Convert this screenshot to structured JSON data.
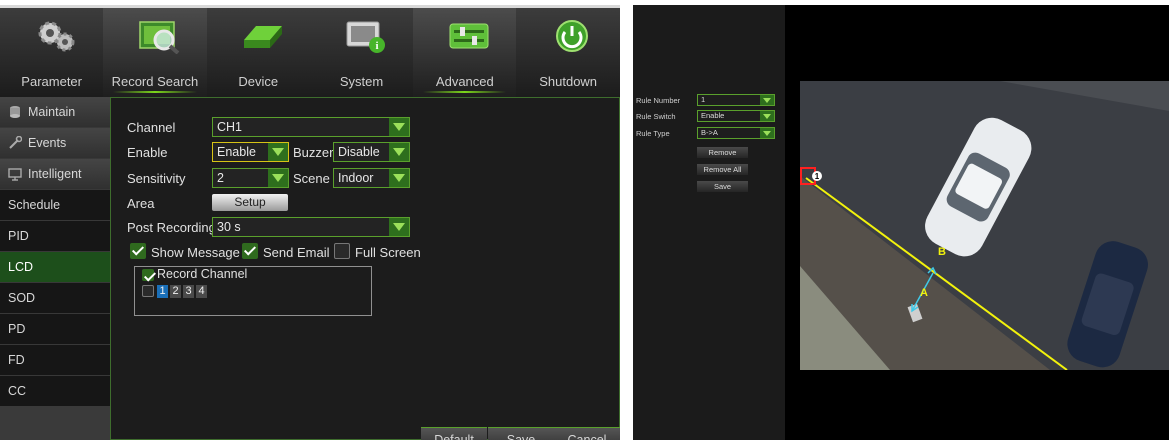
{
  "nav": {
    "items": [
      {
        "label": "Parameter",
        "icon": "gears-icon"
      },
      {
        "label": "Record Search",
        "icon": "record-search-icon"
      },
      {
        "label": "Device",
        "icon": "hard-drive-icon"
      },
      {
        "label": "System",
        "icon": "system-info-icon"
      },
      {
        "label": "Advanced",
        "icon": "sliders-icon"
      },
      {
        "label": "Shutdown",
        "icon": "power-icon"
      }
    ],
    "active": [
      "Record Search",
      "Advanced"
    ]
  },
  "sidebar": {
    "items": [
      {
        "label": "Maintain",
        "icon": "database-icon"
      },
      {
        "label": "Events",
        "icon": "wrench-icon"
      },
      {
        "label": "Intelligent",
        "icon": "monitor-icon"
      },
      {
        "label": "Schedule"
      },
      {
        "label": "PID"
      },
      {
        "label": "LCD"
      },
      {
        "label": "SOD"
      },
      {
        "label": "PD"
      },
      {
        "label": "FD"
      },
      {
        "label": "CC"
      }
    ],
    "active": "LCD"
  },
  "form": {
    "channel_label": "Channel",
    "channel_value": "CH1",
    "enable_label": "Enable",
    "enable_value": "Enable",
    "buzzer_label": "Buzzer",
    "buzzer_value": "Disable",
    "sensitivity_label": "Sensitivity",
    "sensitivity_value": "2",
    "scene_label": "Scene",
    "scene_value": "Indoor",
    "area_label": "Area",
    "setup_button": "Setup",
    "post_recording_label": "Post Recording",
    "post_recording_value": "30 s",
    "show_message": {
      "label": "Show Message",
      "checked": true
    },
    "send_email": {
      "label": "Send Email",
      "checked": true
    },
    "full_screen": {
      "label": "Full Screen",
      "checked": false
    },
    "record_channel": {
      "label": "Record Channel",
      "checked": true
    },
    "channels": [
      "1",
      "2",
      "3",
      "4"
    ],
    "selected_channel": "1"
  },
  "footer": {
    "default": "Default",
    "save": "Save",
    "cancel": "Cancel"
  },
  "rule_panel": {
    "rule_number_label": "Rule Number",
    "rule_number_value": "1",
    "rule_switch_label": "Rule Switch",
    "rule_switch_value": "Enable",
    "rule_type_label": "Rule Type",
    "rule_type_value": "B->A",
    "remove_button": "Remove",
    "remove_all_button": "Remove All",
    "save_button": "Save"
  },
  "camera": {
    "marker_number": "1",
    "label_a": "A",
    "label_b": "B",
    "line_color": "#f2f20c",
    "arrow_color": "#3fc9e8",
    "marker_color": "#ff2020"
  },
  "colors": {
    "accent_green": "#5aa02c",
    "active_row": "#1d4f1b",
    "selected_channel": "#1a6fb8"
  }
}
